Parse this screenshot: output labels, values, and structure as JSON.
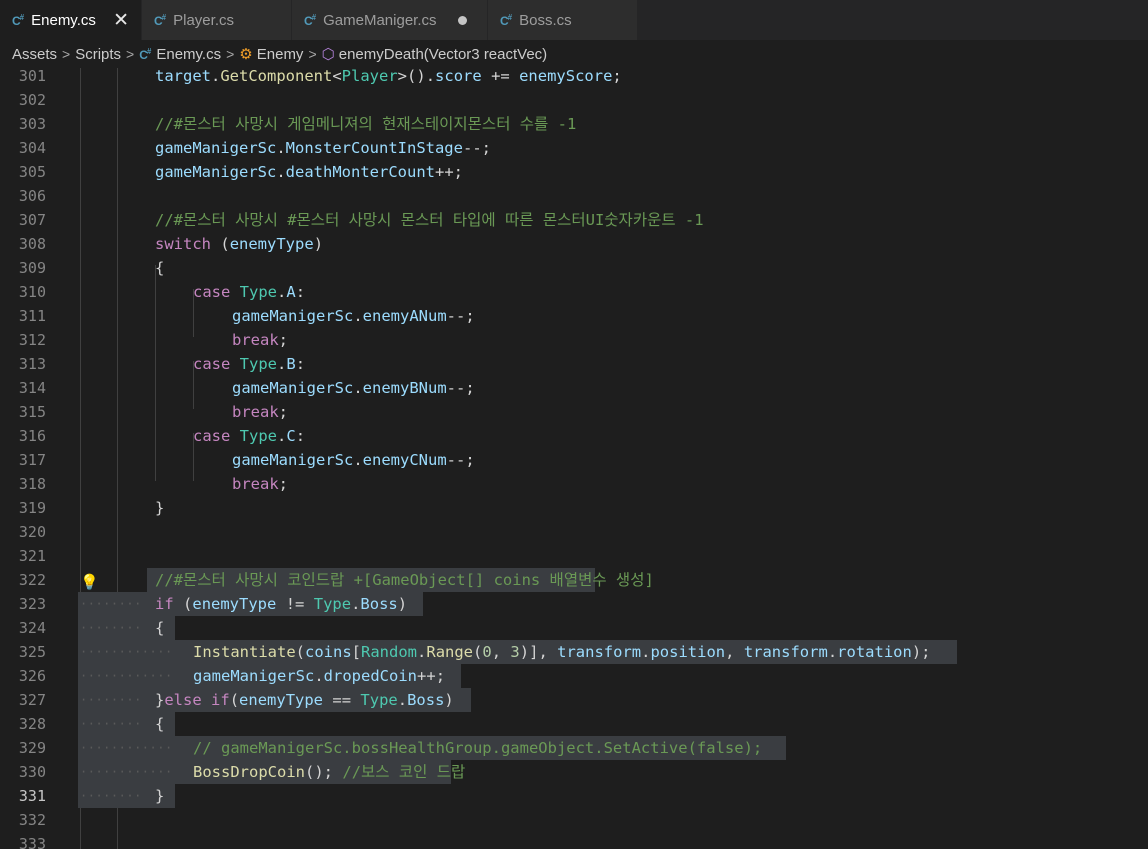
{
  "tabs": [
    {
      "label": "Enemy.cs",
      "active": true,
      "state": "close"
    },
    {
      "label": "Player.cs",
      "active": false,
      "state": ""
    },
    {
      "label": "GameManiger.cs",
      "active": false,
      "state": "modified"
    },
    {
      "label": "Boss.cs",
      "active": false,
      "state": ""
    }
  ],
  "breadcrumb": {
    "assets": "Assets",
    "scripts": "Scripts",
    "file": "Enemy.cs",
    "class": "Enemy",
    "method": "enemyDeath(Vector3 reactVec)"
  },
  "lines": [
    {
      "n": "301",
      "code": "target.GetComponent<Player>().score += enemyScore;"
    },
    {
      "n": "302",
      "code": ""
    },
    {
      "n": "303",
      "code": "//#몬스터 사망시 게임메니져의 현재스테이지몬스터 수를 -1"
    },
    {
      "n": "304",
      "code": "gameManigerSc.MonsterCountInStage--;"
    },
    {
      "n": "305",
      "code": "gameManigerSc.deathMonterCount++;"
    },
    {
      "n": "306",
      "code": ""
    },
    {
      "n": "307",
      "code": "//#몬스터 사망시 #몬스터 사망시 몬스터 타입에 따른 몬스터UI숫자카운트 -1"
    },
    {
      "n": "308",
      "code": "switch (enemyType)"
    },
    {
      "n": "309",
      "code": "{"
    },
    {
      "n": "310",
      "code": "case Type.A:"
    },
    {
      "n": "311",
      "code": "gameManigerSc.enemyANum--;"
    },
    {
      "n": "312",
      "code": "break;"
    },
    {
      "n": "313",
      "code": "case Type.B:"
    },
    {
      "n": "314",
      "code": "gameManigerSc.enemyBNum--;"
    },
    {
      "n": "315",
      "code": "break;"
    },
    {
      "n": "316",
      "code": "case Type.C:"
    },
    {
      "n": "317",
      "code": "gameManigerSc.enemyCNum--;"
    },
    {
      "n": "318",
      "code": "break;"
    },
    {
      "n": "319",
      "code": "}"
    },
    {
      "n": "320",
      "code": ""
    },
    {
      "n": "321",
      "code": ""
    },
    {
      "n": "322",
      "code": "//#몬스터 사망시 코인드랍 +[GameObject[] coins 배열변수 생성]"
    },
    {
      "n": "323",
      "code": "if (enemyType != Type.Boss)"
    },
    {
      "n": "324",
      "code": "{"
    },
    {
      "n": "325",
      "code": "Instantiate(coins[Random.Range(0, 3)], transform.position, transform.rotation);"
    },
    {
      "n": "326",
      "code": "gameManigerSc.dropedCoin++;"
    },
    {
      "n": "327",
      "code": "}else if(enemyType == Type.Boss)"
    },
    {
      "n": "328",
      "code": "{"
    },
    {
      "n": "329",
      "code": "// gameManigerSc.bossHealthGroup.gameObject.SetActive(false);"
    },
    {
      "n": "330",
      "code": "BossDropCoin(); //보스 코인 드랍"
    },
    {
      "n": "331",
      "code": "}"
    },
    {
      "n": "332",
      "code": ""
    },
    {
      "n": "333",
      "code": ""
    }
  ],
  "current_line": "331",
  "icons": {
    "lightbulb": "lightbulb-icon",
    "close": "close-icon",
    "modified": "modified-dot-icon",
    "csharp_file": "csharp-file-icon"
  },
  "colors": {
    "keyword": "#c586c0",
    "type": "#4ec9b0",
    "function": "#dcdcaa",
    "variable": "#9cdcfe",
    "comment": "#6a9955",
    "number": "#b5cea8",
    "selection": "#3a3d41"
  }
}
